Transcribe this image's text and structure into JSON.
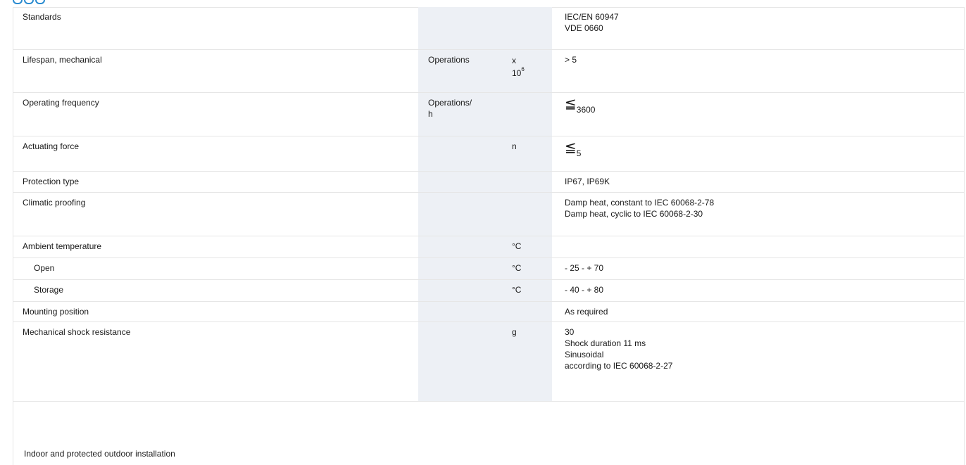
{
  "rows": [
    {
      "label": "Standards",
      "unit1": "",
      "unit2": "",
      "value_lines": [
        "IEC/EN 60947",
        "VDE 0660"
      ]
    },
    {
      "label": "Lifespan, mechanical",
      "unit1": "Operations",
      "unit2_base": "x",
      "unit2_power_base": "10",
      "unit2_exp": "6",
      "value_lines": [
        "> 5"
      ]
    },
    {
      "label": "Operating frequency",
      "unit1": "Operations/\nh",
      "unit2": "",
      "value_symbol": "≦",
      "value_sub": "3600"
    },
    {
      "label": "Actuating force",
      "unit1": "",
      "unit2": "n",
      "value_symbol": "≦",
      "value_sub": "5"
    },
    {
      "label": "Protection type",
      "unit1": "",
      "unit2": "",
      "value_lines": [
        "IP67, IP69K"
      ]
    },
    {
      "label": "Climatic proofing",
      "unit1": "",
      "unit2": "",
      "value_lines": [
        "Damp heat, constant to IEC 60068-2-78",
        "Damp heat, cyclic to IEC 60068-2-30"
      ]
    },
    {
      "label": "Ambient temperature",
      "unit1": "",
      "unit2": "°C",
      "value_lines": []
    },
    {
      "label": "Open",
      "unit1": "",
      "unit2": "°C",
      "value_lines": [
        "- 25 - + 70"
      ]
    },
    {
      "label": "Storage",
      "unit1": "",
      "unit2": "°C",
      "value_lines": [
        "- 40 - + 80"
      ]
    },
    {
      "label": "Mounting position",
      "unit1": "",
      "unit2": "",
      "value_lines": [
        "As required"
      ]
    },
    {
      "label": "Mechanical shock resistance",
      "unit1": "",
      "unit2": "g",
      "value_lines": [
        "30",
        "Shock duration 11 ms",
        "Sinusoidal",
        "according to IEC 60068-2-27"
      ]
    }
  ],
  "footer": {
    "note": "Indoor and protected outdoor installation"
  },
  "colors": {
    "unit_column_bg": "#edf0f5",
    "row_border": "#e6e6e6",
    "accent_blue": "#2a8bd0"
  }
}
